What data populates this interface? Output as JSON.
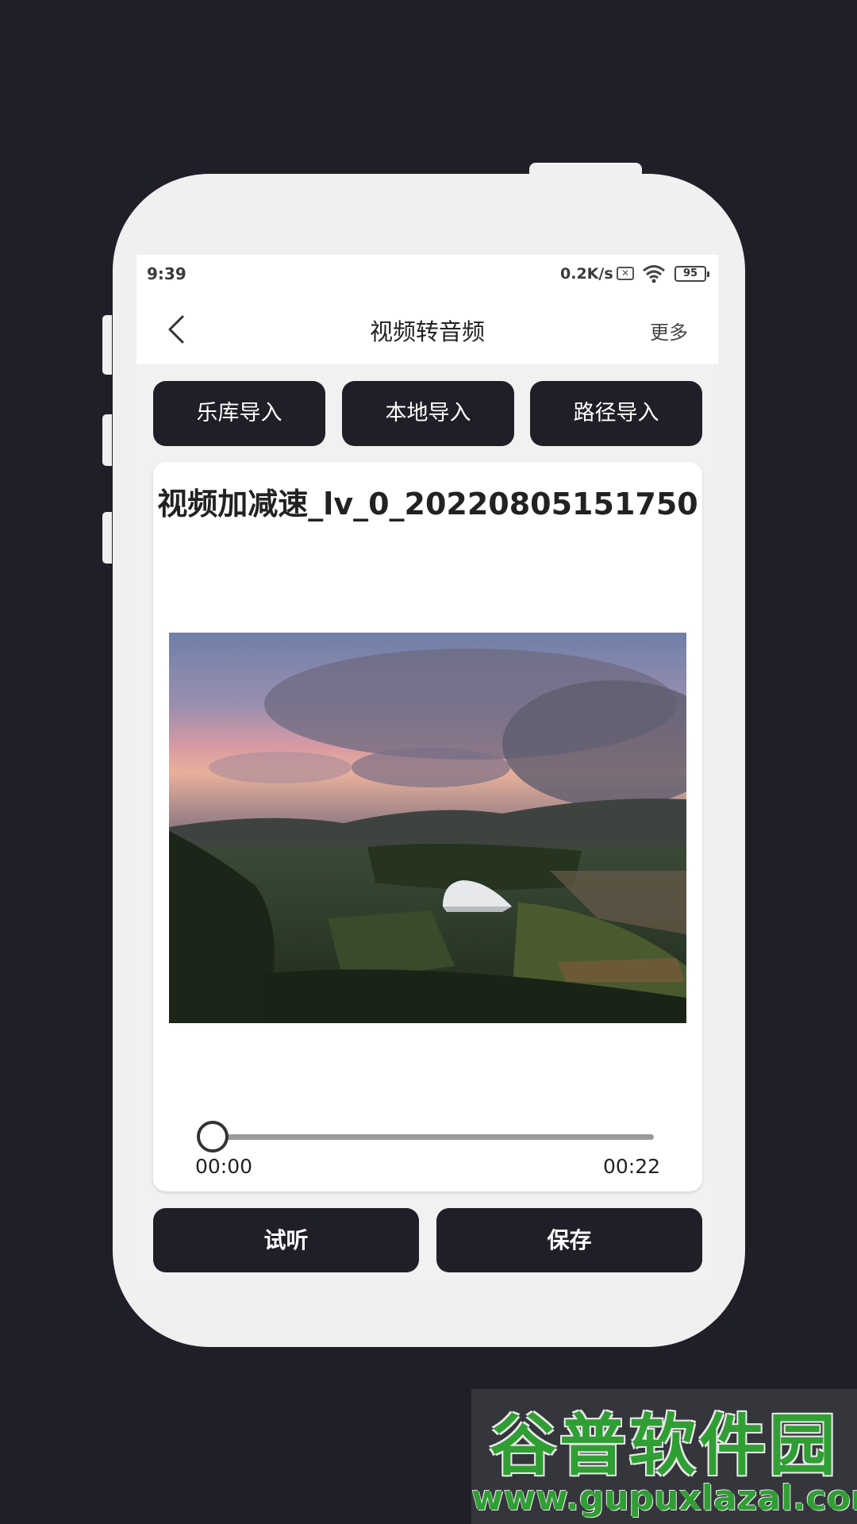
{
  "status_bar": {
    "time": "9:39",
    "net_speed": "0.2K/s",
    "battery": "95"
  },
  "header": {
    "title": "视频转音频",
    "more_label": "更多"
  },
  "import_buttons": {
    "library": "乐库导入",
    "local": "本地导入",
    "path": "路径导入"
  },
  "media": {
    "file_name": "视频加减速_lv_0_20220805151750",
    "current_time": "00:00",
    "total_time": "00:22",
    "progress": 0
  },
  "actions": {
    "preview_label": "试听",
    "save_label": "保存"
  },
  "watermark": {
    "logo_text": "谷普软件园",
    "url": "www.gupuxlazal.com"
  },
  "colors": {
    "background": "#1f1f27",
    "phone_frame": "#f0f0f0",
    "button": "#1f1f27",
    "watermark_green": "#2f9e33"
  }
}
